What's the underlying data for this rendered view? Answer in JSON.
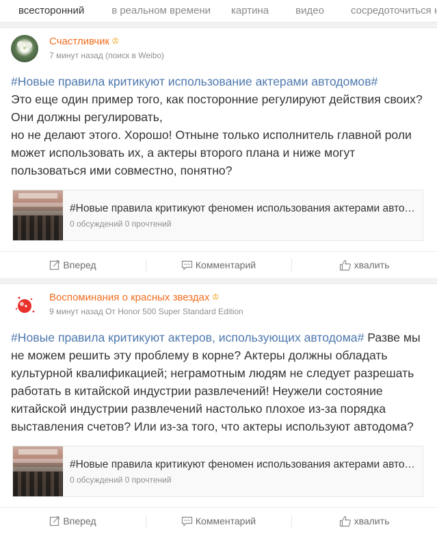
{
  "tabs": [
    "всесторонний",
    "в реальном времени",
    "картина",
    "видео",
    "сосредоточиться на"
  ],
  "posts": [
    {
      "author": "Счастливчик",
      "crown": "♔",
      "meta": "7 минут назад (поиск в Weibo)",
      "paragraphs": [
        {
          "topic": "#Новые правила критикуют использование актерами автодомов#",
          "text": "Это еще один пример того, как посторонние регулируют действия своих? Они должны регулировать,"
        },
        {
          "topic": "",
          "text": "но не делают этого. Хорошо! Отныне только исполнитель главной роли может использовать их, а актеры второго плана и ниже могут пользоваться ими совместно, понятно?"
        }
      ],
      "link_title": "#Новые правила критикуют феномен использования актерами автодомов#",
      "link_stats": "0 обсуждений 0 прочтений",
      "actions": {
        "forward": "Вперед",
        "comment": "Комментарий",
        "like": "хвалить"
      }
    },
    {
      "author": "Воспоминания о красных звездах",
      "crown": "♔",
      "meta": "9 минут назад От Honor 500 Super Standard Edition",
      "paragraphs": [
        {
          "topic": "#Новые правила критикуют актеров, использующих автодома#",
          "text": " Разве мы не можем решить эту проблему в корне? Актеры должны обладать культурной квалификацией; неграмотным людям не следует разрешать работать в китайской индустрии развлечений! Неужели состояние китайской индустрии развлечений настолько плохое из-за порядка выставления счетов? Или из-за того, что актеры используют автодома?"
        }
      ],
      "link_title": "#Новые правила критикуют феномен использования актерами автодомов#",
      "link_stats": "0 обсуждений 0 прочтений",
      "actions": {
        "forward": "Вперед",
        "comment": "Комментарий",
        "like": "хвалить"
      }
    }
  ],
  "colors": {
    "accent": "#f06d1f",
    "topic": "#4e78ad",
    "crown": "#f2a31b"
  },
  "icons": [
    "forward-icon",
    "comment-icon",
    "like-icon",
    "crown-icon"
  ]
}
